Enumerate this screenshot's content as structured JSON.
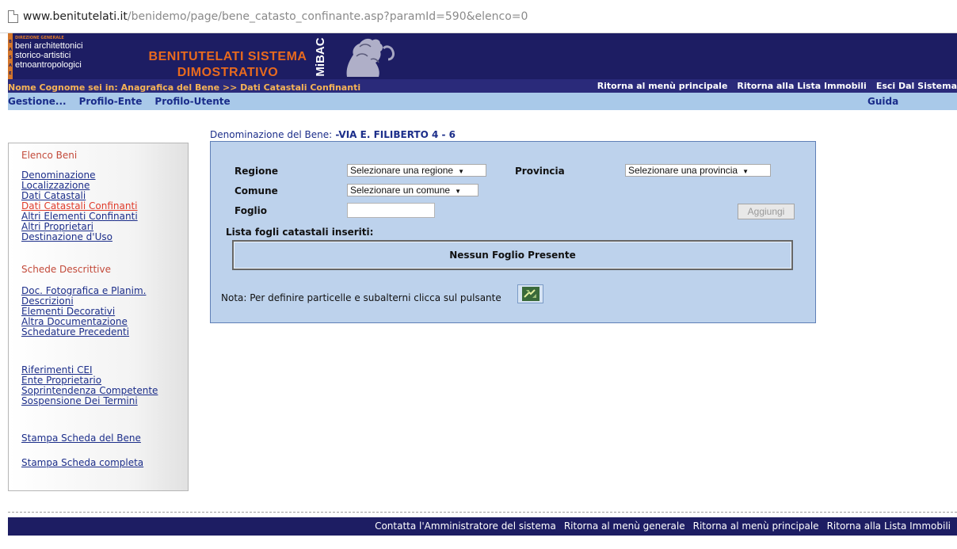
{
  "browser": {
    "url_host": "www.benitutelati.it",
    "url_path": "/benidemo/page/bene_catasto_confinante.asp?paramId=590&elenco=0"
  },
  "banner": {
    "basae_letters": [
      "B",
      "A",
      "S",
      "A",
      "E"
    ],
    "direzione": "DIREZIONE GENERALE",
    "ministry_lines": [
      "beni architettonici",
      "storico-artistici",
      "etnoantropologici"
    ],
    "site_name_line1": "BENITUTELATI SISTEMA",
    "site_name_line2": "DIMOSTRATIVO",
    "mibac": "MiBAC"
  },
  "header": {
    "breadcrumb": "Nome Cognome sei in: Anagrafica del Bene >> Dati Catastali Confinanti",
    "right_links": [
      "Ritorna al menù principale",
      "Ritorna alla Lista Immobili",
      "Esci Dal Sistema"
    ],
    "menu": [
      "Gestione...",
      "Profilo-Ente",
      "Profilo-Utente"
    ],
    "guida": "Guida"
  },
  "sidebar": {
    "section1_title": "Elenco Beni",
    "section1_items": [
      "Denominazione",
      "Localizzazione",
      "Dati Catastali",
      "Dati Catastali Confinanti",
      "Altri Elementi Confinanti",
      "Altri Proprietari",
      "Destinazione d'Uso"
    ],
    "section2_title": "Schede Descrittive",
    "section2_items": [
      "Doc. Fotografica e Planim.",
      "Descrizioni",
      "Elementi Decorativi",
      "Altra Documentazione",
      "Schedature Precedenti"
    ],
    "section3_items": [
      "Riferimenti CEI",
      "Ente Proprietario",
      "Soprintendenza Competente",
      "Sospensione Dei Termini"
    ],
    "stampa_bene": "Stampa Scheda del Bene",
    "stampa_completa": "Stampa Scheda completa"
  },
  "main": {
    "denominazione_label": "Denominazione del Bene:",
    "denominazione_value": "-VIA E. FILIBERTO 4 - 6",
    "form": {
      "regione_label": "Regione",
      "regione_value": "Selezionare una regione",
      "provincia_label": "Provincia",
      "provincia_value": "Selezionare una provincia",
      "comune_label": "Comune",
      "comune_value": "Selezionare un comune",
      "foglio_label": "Foglio",
      "foglio_value": "",
      "aggiungi": "Aggiungi",
      "lista_label": "Lista fogli catastali inseriti:",
      "nessun_foglio": "Nessun Foglio Presente",
      "nota": "Nota: Per definire particelle e subalterni clicca sul pulsante"
    }
  },
  "footer": {
    "links": [
      "Contatta l'Amministratore del sistema",
      "Ritorna al menù generale",
      "Ritorna al menù principale",
      "Ritorna alla Lista Immobili"
    ]
  },
  "colors": {
    "banner_bg": "#1d1d63",
    "accent_orange": "#e86a1e",
    "nav_light": "#a9c9e9",
    "panel_bg": "#bdd2ec",
    "link": "#1c2e8a",
    "active_link": "#e03b2a"
  }
}
